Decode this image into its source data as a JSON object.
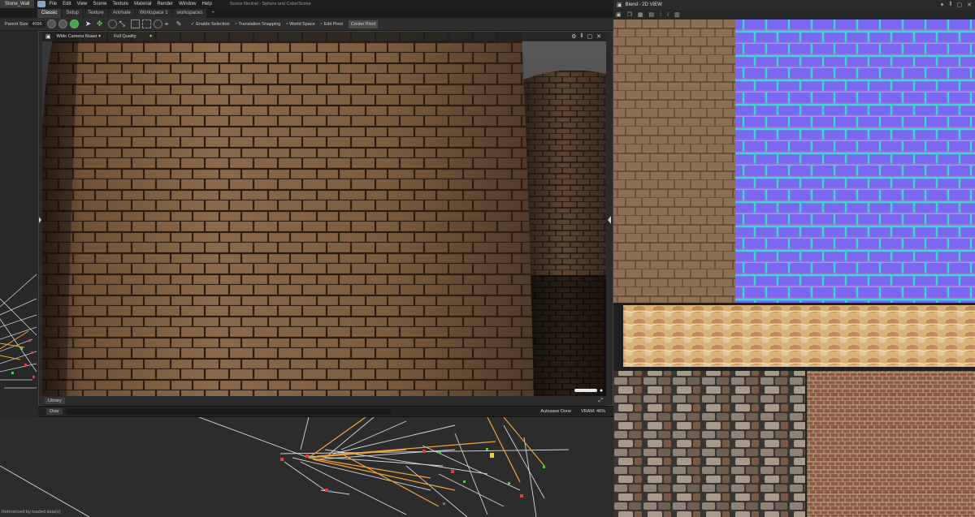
{
  "app": {
    "file_tab": "Stone_Wall",
    "menu": [
      "File",
      "Edit",
      "View",
      "Scene",
      "Texture",
      "Material",
      "Render",
      "Window",
      "Help"
    ],
    "scene_title": "Scene Neutral - Sphere and Cube/Scene"
  },
  "tabs": [
    {
      "label": "Classic",
      "active": true
    },
    {
      "label": "Setup",
      "active": false
    },
    {
      "label": "Texture",
      "active": false
    },
    {
      "label": "Animate",
      "active": false
    },
    {
      "label": "Workspace 1",
      "active": false
    },
    {
      "label": "workspaces",
      "active": false
    },
    {
      "label": "+",
      "active": false
    }
  ],
  "toolbar": {
    "parent_size_label": "Parent Size",
    "parent_size_value": "4096",
    "options": [
      {
        "label": "Enable Selection",
        "checked": true
      },
      {
        "label": "Translation Snapping",
        "checked": false
      },
      {
        "label": "World Space",
        "checked": false
      },
      {
        "label": "Edit Pivot",
        "checked": false
      },
      {
        "label": "Center Pivot",
        "button": true
      }
    ]
  },
  "viewport": {
    "camera": "Wide Camera Nuaer",
    "quality": "Full Quality"
  },
  "library_label": "Library",
  "status": {
    "filter_button": "Over",
    "autosave": "Autosave Done",
    "vram": "VRAM: 46%"
  },
  "node_graph": {
    "footer": "Referenced by loaded data(s)"
  },
  "view2d": {
    "title": "Blend - 2D VIEW"
  },
  "colors": {
    "accent_green": "#49a34a",
    "node_orange": "#f2a23a",
    "normal_map_blue": "#7a66ee"
  }
}
